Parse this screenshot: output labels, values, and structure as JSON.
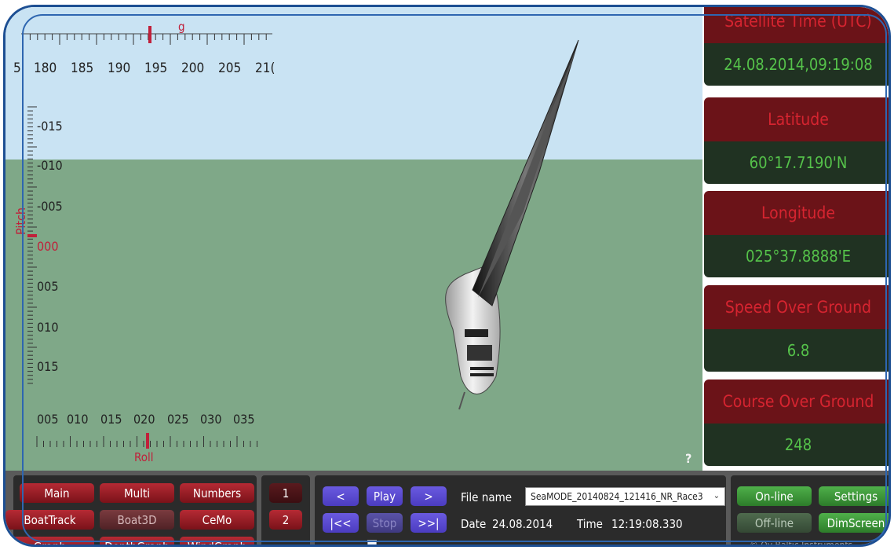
{
  "compass": {
    "labels": [
      "5",
      "180",
      "185",
      "190",
      "195",
      "200",
      "205",
      "21("
    ],
    "heading_marker": "g"
  },
  "pitch": {
    "title": "Pitch",
    "labels": [
      "-015",
      "-010",
      "-005",
      "000",
      "005",
      "010",
      "015"
    ]
  },
  "roll": {
    "title": "Roll",
    "labels": [
      "005",
      "010",
      "015",
      "020",
      "025",
      "030",
      "035"
    ]
  },
  "help_label": "?",
  "tiles": [
    {
      "title": "Satellite Time (UTC)",
      "value": "24.08.2014,09:19:08"
    },
    {
      "title": "Latitude",
      "value": "60°17.7190'N"
    },
    {
      "title": "Longitude",
      "value": "025°37.8888'E"
    },
    {
      "title": "Speed Over Ground",
      "value": "6.8"
    },
    {
      "title": "Course Over Ground",
      "value": "248"
    }
  ],
  "nav": {
    "main": "Main",
    "multi": "Multi",
    "numbers": "Numbers",
    "boattrack": "BoatTrack",
    "boat3d": "Boat3D",
    "cemo": "CeMo",
    "graph": "Graph",
    "depthgraph": "DepthGraph",
    "windgraph": "WindGraph"
  },
  "pages": {
    "one": "1",
    "two": "2"
  },
  "playback": {
    "prev": "<",
    "play": "Play",
    "next": ">",
    "first": "|<<",
    "stop": "Stop",
    "last": ">>|",
    "file_label": "File name",
    "file_value": "SeaMODE_20140824_121416_NR_Race3",
    "date_label": "Date",
    "date_value": "24.08.2014",
    "time_label": "Time",
    "time_value": "12:19:08.330",
    "progress": 0.12
  },
  "mode": {
    "online": "On-line",
    "settings": "Settings",
    "offline": "Off-line",
    "dimscreen": "DimScreen",
    "copyright": "© Oy Baltic Instruments"
  },
  "colors": {
    "accent_red": "#6b1318",
    "value_green": "#55c24a",
    "sky": "#c9e3f3",
    "ground": "#7fa888"
  }
}
